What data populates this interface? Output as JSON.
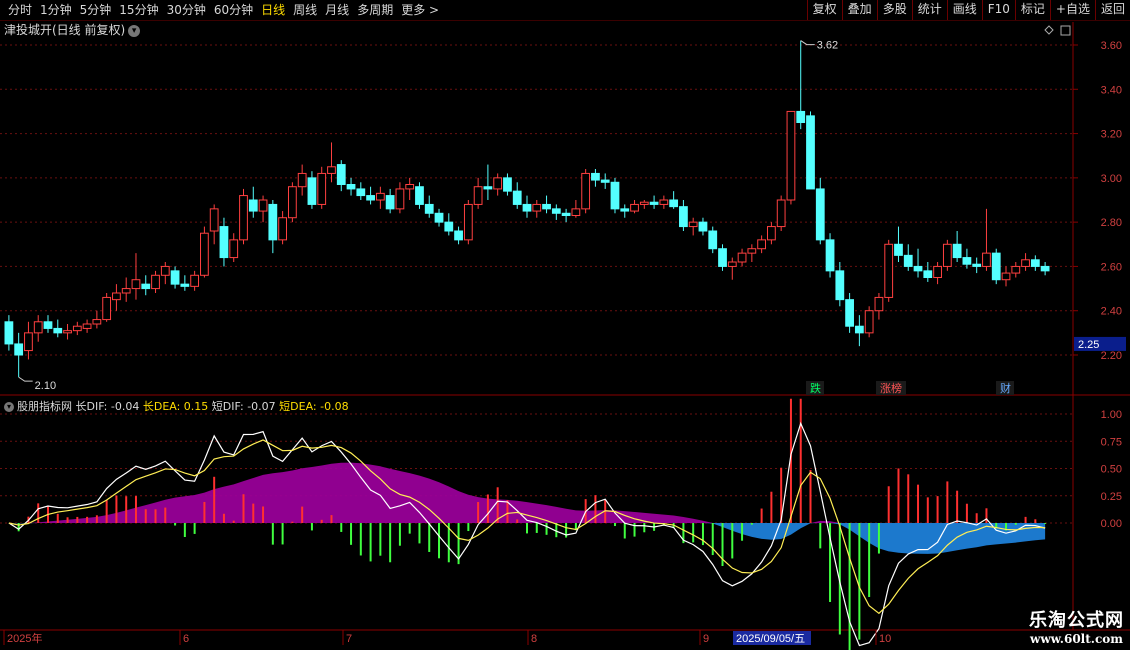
{
  "toolbar": {
    "left": [
      {
        "label": "分时",
        "active": false
      },
      {
        "label": "1分钟",
        "active": false
      },
      {
        "label": "5分钟",
        "active": false
      },
      {
        "label": "15分钟",
        "active": false
      },
      {
        "label": "30分钟",
        "active": false
      },
      {
        "label": "60分钟",
        "active": false
      },
      {
        "label": "日线",
        "active": true
      },
      {
        "label": "周线",
        "active": false
      },
      {
        "label": "月线",
        "active": false
      },
      {
        "label": "多周期",
        "active": false
      },
      {
        "label": "更多 >",
        "active": false
      }
    ],
    "right": [
      "复权",
      "叠加",
      "多股",
      "统计",
      "画线",
      "F10",
      "标记",
      "+自选",
      "返回"
    ]
  },
  "stock_title": "津投城开(日线 前复权)",
  "indicator": {
    "name": "股朋指标网",
    "items": [
      {
        "text": "长DIF: -0.04",
        "color": "#d8d8d8"
      },
      {
        "text": "长DEA: 0.15",
        "color": "#ffdd00"
      },
      {
        "text": "短DIF: -0.07",
        "color": "#d8d8d8"
      },
      {
        "text": "短DEA: -0.08",
        "color": "#ffdd00"
      }
    ]
  },
  "price_axis": {
    "labels": [
      "3.60",
      "3.40",
      "3.20",
      "3.00",
      "2.80",
      "2.60",
      "2.40",
      "2.20"
    ],
    "min": 2.0,
    "max": 3.7,
    "current": "2.25"
  },
  "ind_axis": {
    "labels": [
      "1.00",
      "0.75",
      "0.50",
      "0.25",
      "0.00"
    ]
  },
  "annotations": {
    "high": "3.62",
    "low": "2.10"
  },
  "events": [
    {
      "label": "跌",
      "color": "#00ff66"
    },
    {
      "label": "涨榜",
      "color": "#ff5555"
    },
    {
      "label": "财",
      "color": "#66aaff"
    }
  ],
  "date_axis": {
    "labels": [
      "2025年",
      "6",
      "7",
      "8",
      "9",
      "10"
    ],
    "highlight": "2025/09/05/五"
  },
  "watermark": {
    "line1": "乐淘公式网",
    "line2": "www.60lt.com"
  },
  "colors": {
    "up": "#ff4040",
    "down": "#54ffff",
    "macd_up": "#ff3030",
    "macd_down": "#40ff40",
    "long_area_pos": "#a000a0",
    "long_area_neg": "#1e7fd8"
  },
  "chart_data": {
    "type": "candlestick",
    "series": [
      {
        "name": "OHLC",
        "values": [
          [
            2.35,
            2.38,
            2.22,
            2.25
          ],
          [
            2.25,
            2.3,
            2.1,
            2.2
          ],
          [
            2.22,
            2.35,
            2.18,
            2.3
          ],
          [
            2.3,
            2.38,
            2.26,
            2.35
          ],
          [
            2.35,
            2.38,
            2.3,
            2.32
          ],
          [
            2.32,
            2.36,
            2.28,
            2.3
          ],
          [
            2.3,
            2.34,
            2.27,
            2.31
          ],
          [
            2.31,
            2.35,
            2.29,
            2.33
          ],
          [
            2.32,
            2.36,
            2.3,
            2.34
          ],
          [
            2.34,
            2.4,
            2.32,
            2.36
          ],
          [
            2.36,
            2.48,
            2.35,
            2.46
          ],
          [
            2.45,
            2.52,
            2.4,
            2.48
          ],
          [
            2.48,
            2.55,
            2.44,
            2.5
          ],
          [
            2.5,
            2.66,
            2.45,
            2.54
          ],
          [
            2.52,
            2.56,
            2.47,
            2.5
          ],
          [
            2.5,
            2.58,
            2.48,
            2.56
          ],
          [
            2.56,
            2.62,
            2.52,
            2.6
          ],
          [
            2.58,
            2.6,
            2.5,
            2.52
          ],
          [
            2.52,
            2.56,
            2.49,
            2.51
          ],
          [
            2.51,
            2.58,
            2.49,
            2.56
          ],
          [
            2.56,
            2.78,
            2.55,
            2.75
          ],
          [
            2.76,
            2.88,
            2.7,
            2.86
          ],
          [
            2.78,
            2.82,
            2.6,
            2.64
          ],
          [
            2.64,
            2.75,
            2.62,
            2.72
          ],
          [
            2.72,
            2.95,
            2.7,
            2.92
          ],
          [
            2.9,
            2.96,
            2.82,
            2.85
          ],
          [
            2.85,
            2.92,
            2.8,
            2.9
          ],
          [
            2.88,
            2.9,
            2.66,
            2.72
          ],
          [
            2.72,
            2.85,
            2.7,
            2.82
          ],
          [
            2.82,
            2.98,
            2.8,
            2.96
          ],
          [
            2.96,
            3.06,
            2.92,
            3.02
          ],
          [
            3.0,
            3.03,
            2.86,
            2.88
          ],
          [
            2.88,
            3.05,
            2.86,
            3.02
          ],
          [
            3.02,
            3.16,
            2.98,
            3.05
          ],
          [
            3.06,
            3.08,
            2.94,
            2.97
          ],
          [
            2.97,
            3.0,
            2.92,
            2.95
          ],
          [
            2.95,
            2.98,
            2.9,
            2.92
          ],
          [
            2.92,
            2.96,
            2.88,
            2.9
          ],
          [
            2.9,
            2.96,
            2.86,
            2.93
          ],
          [
            2.92,
            2.95,
            2.84,
            2.86
          ],
          [
            2.86,
            2.98,
            2.84,
            2.95
          ],
          [
            2.95,
            3.0,
            2.9,
            2.97
          ],
          [
            2.96,
            2.98,
            2.86,
            2.88
          ],
          [
            2.88,
            2.92,
            2.82,
            2.84
          ],
          [
            2.84,
            2.86,
            2.78,
            2.8
          ],
          [
            2.8,
            2.84,
            2.74,
            2.76
          ],
          [
            2.76,
            2.78,
            2.7,
            2.72
          ],
          [
            2.72,
            2.9,
            2.7,
            2.88
          ],
          [
            2.88,
            3.0,
            2.86,
            2.96
          ],
          [
            2.96,
            3.06,
            2.9,
            2.95
          ],
          [
            2.95,
            3.02,
            2.92,
            3.0
          ],
          [
            3.0,
            3.02,
            2.92,
            2.94
          ],
          [
            2.94,
            2.98,
            2.86,
            2.88
          ],
          [
            2.88,
            2.92,
            2.82,
            2.85
          ],
          [
            2.85,
            2.9,
            2.82,
            2.88
          ],
          [
            2.88,
            2.92,
            2.84,
            2.86
          ],
          [
            2.86,
            2.88,
            2.81,
            2.84
          ],
          [
            2.84,
            2.86,
            2.8,
            2.83
          ],
          [
            2.83,
            2.9,
            2.82,
            2.86
          ],
          [
            2.86,
            3.04,
            2.84,
            3.02
          ],
          [
            3.02,
            3.04,
            2.96,
            2.99
          ],
          [
            2.99,
            3.02,
            2.95,
            2.98
          ],
          [
            2.98,
            3.0,
            2.84,
            2.86
          ],
          [
            2.86,
            2.88,
            2.82,
            2.85
          ],
          [
            2.85,
            2.9,
            2.84,
            2.88
          ],
          [
            2.88,
            2.9,
            2.86,
            2.89
          ],
          [
            2.89,
            2.92,
            2.86,
            2.88
          ],
          [
            2.88,
            2.92,
            2.86,
            2.9
          ],
          [
            2.9,
            2.94,
            2.86,
            2.87
          ],
          [
            2.87,
            2.9,
            2.76,
            2.78
          ],
          [
            2.78,
            2.82,
            2.74,
            2.8
          ],
          [
            2.8,
            2.82,
            2.74,
            2.76
          ],
          [
            2.76,
            2.78,
            2.66,
            2.68
          ],
          [
            2.68,
            2.7,
            2.58,
            2.6
          ],
          [
            2.6,
            2.64,
            2.54,
            2.62
          ],
          [
            2.62,
            2.68,
            2.6,
            2.66
          ],
          [
            2.66,
            2.7,
            2.62,
            2.68
          ],
          [
            2.68,
            2.74,
            2.66,
            2.72
          ],
          [
            2.72,
            2.8,
            2.7,
            2.78
          ],
          [
            2.78,
            2.92,
            2.76,
            2.9
          ],
          [
            2.9,
            3.3,
            2.88,
            3.3
          ],
          [
            3.3,
            3.62,
            3.22,
            3.25
          ],
          [
            3.28,
            3.3,
            2.95,
            2.95
          ],
          [
            2.95,
            3.0,
            2.7,
            2.72
          ],
          [
            2.72,
            2.75,
            2.55,
            2.58
          ],
          [
            2.58,
            2.62,
            2.42,
            2.45
          ],
          [
            2.45,
            2.48,
            2.3,
            2.33
          ],
          [
            2.33,
            2.38,
            2.24,
            2.3
          ],
          [
            2.3,
            2.42,
            2.28,
            2.4
          ],
          [
            2.4,
            2.48,
            2.36,
            2.46
          ],
          [
            2.46,
            2.72,
            2.44,
            2.7
          ],
          [
            2.7,
            2.78,
            2.62,
            2.65
          ],
          [
            2.65,
            2.7,
            2.58,
            2.6
          ],
          [
            2.6,
            2.68,
            2.55,
            2.58
          ],
          [
            2.58,
            2.62,
            2.53,
            2.55
          ],
          [
            2.55,
            2.62,
            2.52,
            2.6
          ],
          [
            2.6,
            2.72,
            2.58,
            2.7
          ],
          [
            2.7,
            2.76,
            2.62,
            2.64
          ],
          [
            2.64,
            2.68,
            2.59,
            2.61
          ],
          [
            2.61,
            2.64,
            2.57,
            2.6
          ],
          [
            2.6,
            2.86,
            2.58,
            2.66
          ],
          [
            2.66,
            2.68,
            2.52,
            2.54
          ],
          [
            2.54,
            2.6,
            2.51,
            2.57
          ],
          [
            2.57,
            2.62,
            2.55,
            2.6
          ],
          [
            2.6,
            2.66,
            2.58,
            2.63
          ],
          [
            2.63,
            2.65,
            2.58,
            2.6
          ],
          [
            2.6,
            2.62,
            2.56,
            2.58
          ]
        ]
      }
    ]
  }
}
